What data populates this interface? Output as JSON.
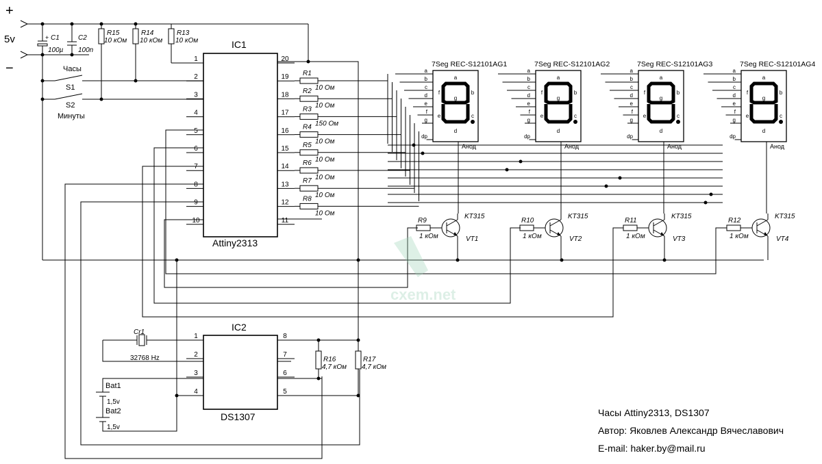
{
  "power": {
    "plus": "+",
    "minus": "−",
    "voltage": "5v"
  },
  "ic1": {
    "title": "IC1",
    "name": "Attiny2313",
    "left_pins": [
      "1",
      "2",
      "3",
      "4",
      "5",
      "6",
      "7",
      "8",
      "9",
      "10"
    ],
    "right_pins": [
      "20",
      "19",
      "18",
      "17",
      "16",
      "15",
      "14",
      "13",
      "12",
      "11"
    ]
  },
  "ic2": {
    "title": "IC2",
    "name": "DS1307",
    "left_pins": [
      "1",
      "2",
      "3",
      "4"
    ],
    "right_pins": [
      "8",
      "7",
      "6",
      "5"
    ]
  },
  "capacitors": [
    {
      "name": "C1",
      "value": "100µ",
      "polarity": "+"
    },
    {
      "name": "C2",
      "value": "100n"
    }
  ],
  "top_resistors": [
    {
      "name": "R15",
      "value": "10 кОм"
    },
    {
      "name": "R14",
      "value": "10 кОм"
    },
    {
      "name": "R13",
      "value": "10 кОм"
    }
  ],
  "segment_resistors": [
    {
      "name": "R1",
      "value": "10 Ом"
    },
    {
      "name": "R2",
      "value": "10 Ом"
    },
    {
      "name": "R3",
      "value": "150 Ом"
    },
    {
      "name": "R4",
      "value": "10 Ом"
    },
    {
      "name": "R5",
      "value": "10 Ом"
    },
    {
      "name": "R6",
      "value": "10 Ом"
    },
    {
      "name": "R7",
      "value": "10 Ом"
    },
    {
      "name": "R8",
      "value": "10 Ом"
    }
  ],
  "switches": {
    "hours_label": "Часы",
    "minutes_label": "Минуты",
    "s1": "S1",
    "s2": "S2"
  },
  "displays": [
    {
      "name": "7Seg REC-S12101AG1",
      "anode": "Анод"
    },
    {
      "name": "7Seg REC-S12101AG2",
      "anode": "Анод"
    },
    {
      "name": "7Seg REC-S12101AG3",
      "anode": "Анод"
    },
    {
      "name": "7Seg REC-S12101AG4",
      "anode": "Анод"
    }
  ],
  "segment_pins": [
    "a",
    "b",
    "c",
    "d",
    "e",
    "f",
    "g",
    "dp"
  ],
  "transistors": [
    {
      "name": "VT1",
      "type": "KT315",
      "base_resistor": "R9",
      "base_value": "1 кОм"
    },
    {
      "name": "VT2",
      "type": "KT315",
      "base_resistor": "R10",
      "base_value": "1 кОм"
    },
    {
      "name": "VT3",
      "type": "KT315",
      "base_resistor": "R11",
      "base_value": "1 кОм"
    },
    {
      "name": "VT4",
      "type": "KT315",
      "base_resistor": "R12",
      "base_value": "1 кОм"
    }
  ],
  "crystal": {
    "name": "Cr1",
    "freq": "32768 Hz"
  },
  "batteries": [
    {
      "name": "Bat1",
      "voltage": "1,5v"
    },
    {
      "name": "Bat2",
      "voltage": "1,5v"
    }
  ],
  "pullups": [
    {
      "name": "R16",
      "value": "4,7 кОм"
    },
    {
      "name": "R17",
      "value": "4,7 кОм"
    }
  ],
  "watermark": "cxem.net",
  "info": {
    "title": "Часы Attiny2313, DS1307",
    "author": "Автор: Яковлев Александр Вячеславович",
    "email": "E-mail: haker.by@mail.ru"
  }
}
